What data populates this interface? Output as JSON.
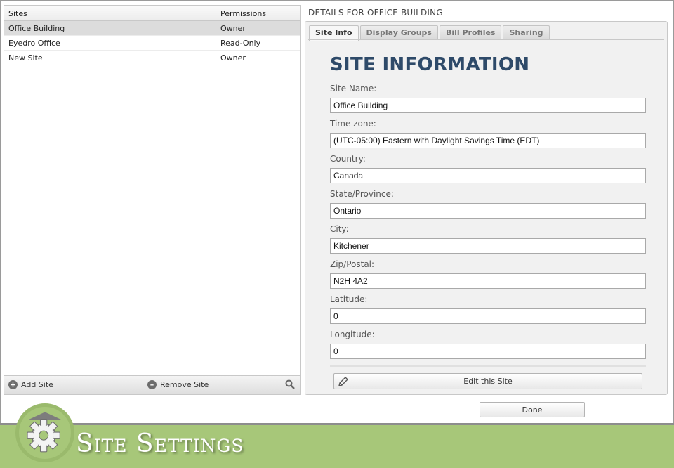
{
  "sites_grid": {
    "columns": [
      "Sites",
      "Permissions"
    ],
    "rows": [
      {
        "site": "Office Building",
        "permission": "Owner",
        "selected": true
      },
      {
        "site": "Eyedro Office",
        "permission": "Read-Only",
        "selected": false
      },
      {
        "site": "New Site",
        "permission": "Owner",
        "selected": false
      }
    ],
    "footer": {
      "add_label": "Add Site",
      "remove_label": "Remove Site",
      "add_icon": "plus-circle-icon",
      "remove_icon": "minus-circle-icon",
      "search_icon": "search-icon"
    }
  },
  "details": {
    "title": "DETAILS FOR OFFICE BUILDING",
    "tabs": [
      {
        "label": "Site Info",
        "active": true
      },
      {
        "label": "Display Groups",
        "active": false
      },
      {
        "label": "Bill Profiles",
        "active": false
      },
      {
        "label": "Sharing",
        "active": false
      }
    ],
    "heading": "SITE INFORMATION",
    "fields": [
      {
        "label": "Site Name:",
        "value": "Office Building"
      },
      {
        "label": "Time zone:",
        "value": "(UTC-05:00) Eastern with Daylight Savings Time (EDT)"
      },
      {
        "label": "Country:",
        "value": "Canada"
      },
      {
        "label": "State/Province:",
        "value": "Ontario"
      },
      {
        "label": "City:",
        "value": "Kitchener"
      },
      {
        "label": "Zip/Postal:",
        "value": "N2H 4A2"
      },
      {
        "label": "Latitude:",
        "value": "0"
      },
      {
        "label": "Longitude:",
        "value": "0"
      }
    ],
    "edit_button": "Edit this Site"
  },
  "done_button": "Done",
  "banner": {
    "title": "Site Settings",
    "icon": "gear-icon"
  },
  "colors": {
    "heading": "#2e4a69",
    "banner": "#a7c779",
    "selected_row": "#dcdcdc"
  }
}
